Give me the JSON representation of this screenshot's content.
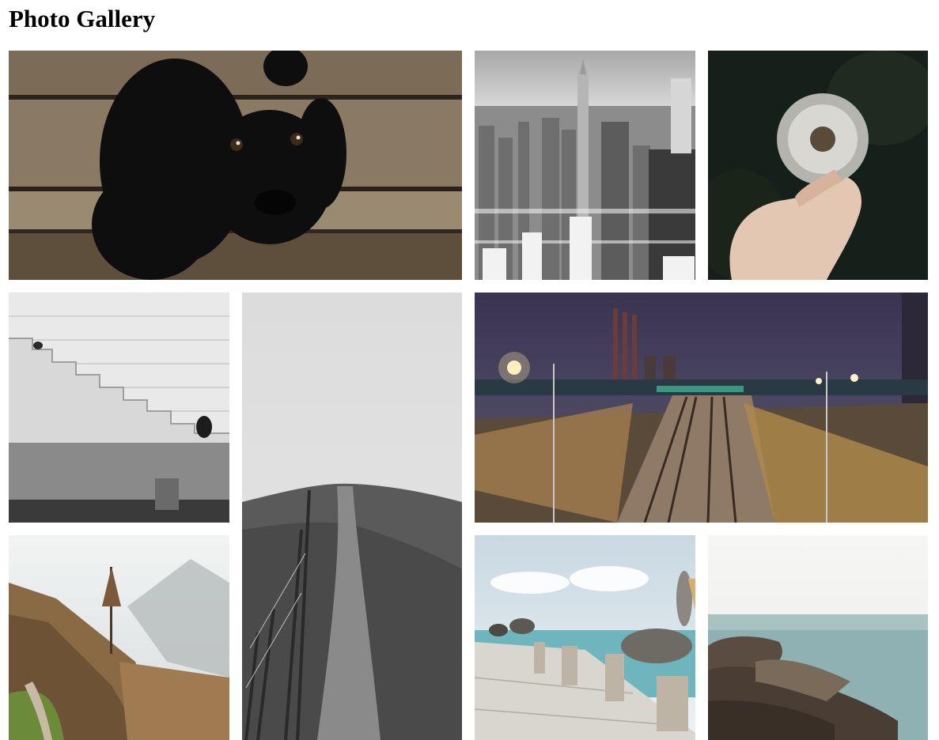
{
  "header": {
    "title": "Photo Gallery"
  },
  "gallery": {
    "photos": [
      {
        "id": "dog",
        "subject": "black-puppy-on-wood-floor"
      },
      {
        "id": "city",
        "subject": "bw-city-skyline"
      },
      {
        "id": "dandelion",
        "subject": "hand-holding-dandelion"
      },
      {
        "id": "stairs",
        "subject": "person-on-stone-stairs"
      },
      {
        "id": "hill",
        "subject": "bw-hill-path-with-fence"
      },
      {
        "id": "railway",
        "subject": "railway-tracks-at-night"
      },
      {
        "id": "forest",
        "subject": "misty-mountain-forest"
      },
      {
        "id": "pelican",
        "subject": "pelicans-on-pier"
      },
      {
        "id": "rocks",
        "subject": "rocky-coast-sea"
      }
    ]
  },
  "colors": {
    "background": "#ffffff",
    "title": "#000000"
  }
}
